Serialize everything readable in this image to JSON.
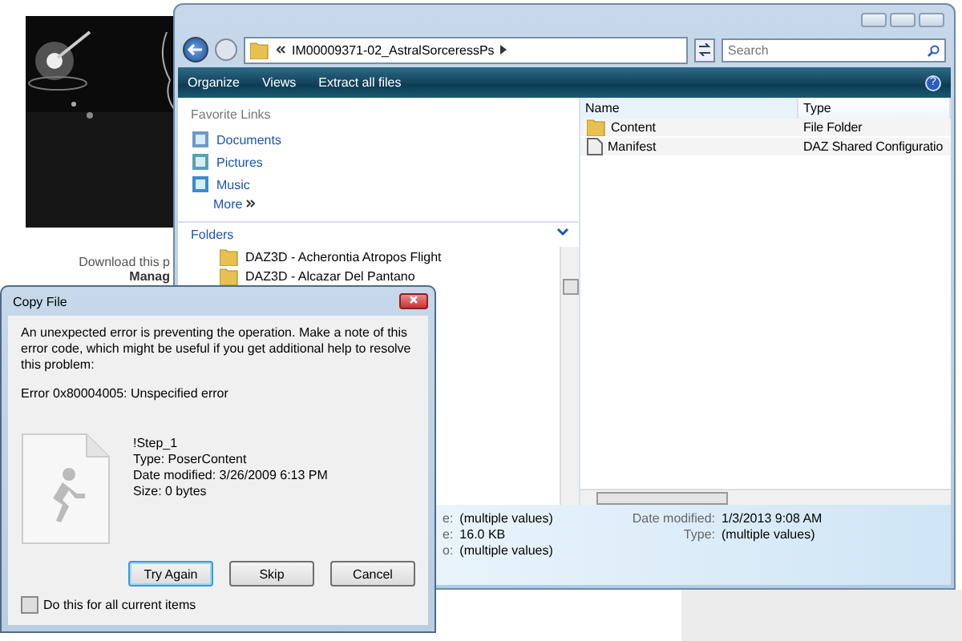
{
  "web_page": {
    "caption": "Download this p",
    "caption_2": "Manag"
  },
  "explorer": {
    "address": "IM00009371-02_AstralSorceressPs",
    "search": {
      "placeholder": "Search"
    },
    "toolbar": [
      "Organize",
      "Views",
      "Extract all files"
    ],
    "help": "?",
    "favorite_links": {
      "title": "Favorite Links",
      "items": [
        {
          "label": "Documents",
          "kind": "documents"
        },
        {
          "label": "Pictures",
          "kind": "pictures"
        },
        {
          "label": "Music",
          "kind": "music"
        }
      ],
      "more": "More"
    },
    "folders": {
      "title": "Folders",
      "items": [
        "DAZ3D - Acherontia Atropos Flight",
        "DAZ3D - Alcazar Del Pantano"
      ]
    },
    "columns": [
      "Name",
      "Type"
    ],
    "files": [
      {
        "name": "Content",
        "type": "File Folder",
        "kind": "folder"
      },
      {
        "name": "Manifest",
        "type": "DAZ Shared Configuratio",
        "kind": "file"
      }
    ],
    "details": {
      "left": [
        {
          "label": "e:",
          "value": "(multiple values)"
        },
        {
          "label": "e:",
          "value": "16.0 KB"
        },
        {
          "label": "o:",
          "value": "(multiple values)"
        }
      ],
      "right": [
        {
          "label": "Date modified:",
          "value": "1/3/2013 9:08 AM"
        },
        {
          "label": "Type:",
          "value": "(multiple values)"
        }
      ]
    }
  },
  "dialog": {
    "title": "Copy File",
    "message": "An unexpected error is preventing the operation. Make a note of this error code, which might be useful if you get additional help to resolve this problem:",
    "error": "Error 0x80004005: Unspecified error",
    "file": [
      "!Step_1",
      "Type: PoserContent",
      "Date modified: 3/26/2009 6:13 PM",
      "Size: 0 bytes"
    ],
    "buttons": [
      {
        "label": "Try Again",
        "selected": true
      },
      {
        "label": "Skip",
        "selected": false
      },
      {
        "label": "Cancel",
        "selected": false
      }
    ],
    "checkbox": {
      "label": "Do this for all current items",
      "checked": false
    }
  }
}
